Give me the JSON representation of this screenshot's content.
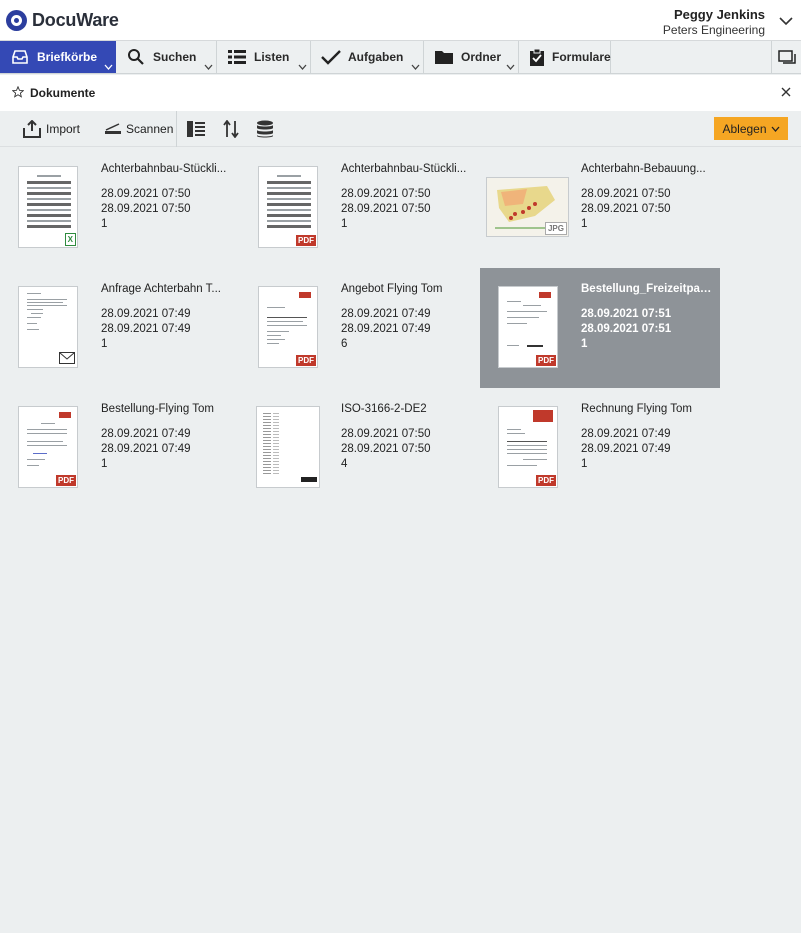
{
  "app": {
    "brand": "DocuWare",
    "accent": "#3449b5",
    "action_color": "#f5a623"
  },
  "user": {
    "name": "Peggy Jenkins",
    "organization": "Peters Engineering"
  },
  "nav": {
    "items": [
      {
        "label": "Briefkörbe",
        "icon": "tray-icon",
        "active": true
      },
      {
        "label": "Suchen",
        "icon": "search-icon"
      },
      {
        "label": "Listen",
        "icon": "list-icon"
      },
      {
        "label": "Aufgaben",
        "icon": "checkmark-icon"
      },
      {
        "label": "Ordner",
        "icon": "folder-icon"
      },
      {
        "label": "Formulare",
        "icon": "clipboard-icon"
      }
    ]
  },
  "dock": {
    "title": "Dokumente"
  },
  "toolbar": {
    "import_label": "Import",
    "scan_label": "Scannen",
    "store_label": "Ablegen"
  },
  "documents": [
    {
      "name": "Achterbahnbau-Stückli...",
      "created": "28.09.2021 07:50",
      "modified": "28.09.2021 07:50",
      "count": "1",
      "type": "xls",
      "selected": false
    },
    {
      "name": "Achterbahnbau-Stückli...",
      "created": "28.09.2021 07:50",
      "modified": "28.09.2021 07:50",
      "count": "1",
      "type": "pdf",
      "selected": false
    },
    {
      "name": "Achterbahn-Bebauung...",
      "created": "28.09.2021 07:50",
      "modified": "28.09.2021 07:50",
      "count": "1",
      "type": "jpg",
      "selected": false
    },
    {
      "name": "Anfrage Achterbahn T...",
      "created": "28.09.2021 07:49",
      "modified": "28.09.2021 07:49",
      "count": "1",
      "type": "msg",
      "selected": false
    },
    {
      "name": "Angebot Flying Tom",
      "created": "28.09.2021 07:49",
      "modified": "28.09.2021 07:49",
      "count": "6",
      "type": "pdf",
      "selected": false
    },
    {
      "name": "Bestellung_Freizeitpar...",
      "created": "28.09.2021 07:51",
      "modified": "28.09.2021 07:51",
      "count": "1",
      "type": "pdf",
      "selected": true
    },
    {
      "name": "Bestellung-Flying Tom",
      "created": "28.09.2021 07:49",
      "modified": "28.09.2021 07:49",
      "count": "1",
      "type": "pdf",
      "selected": false
    },
    {
      "name": "ISO-3166-2-DE2",
      "created": "28.09.2021 07:50",
      "modified": "28.09.2021 07:50",
      "count": "4",
      "type": "tif",
      "selected": false
    },
    {
      "name": "Rechnung Flying Tom",
      "created": "28.09.2021 07:49",
      "modified": "28.09.2021 07:49",
      "count": "1",
      "type": "pdf",
      "selected": false
    }
  ],
  "badges": {
    "pdf": "PDF",
    "xls": "X",
    "jpg": "JPG"
  }
}
